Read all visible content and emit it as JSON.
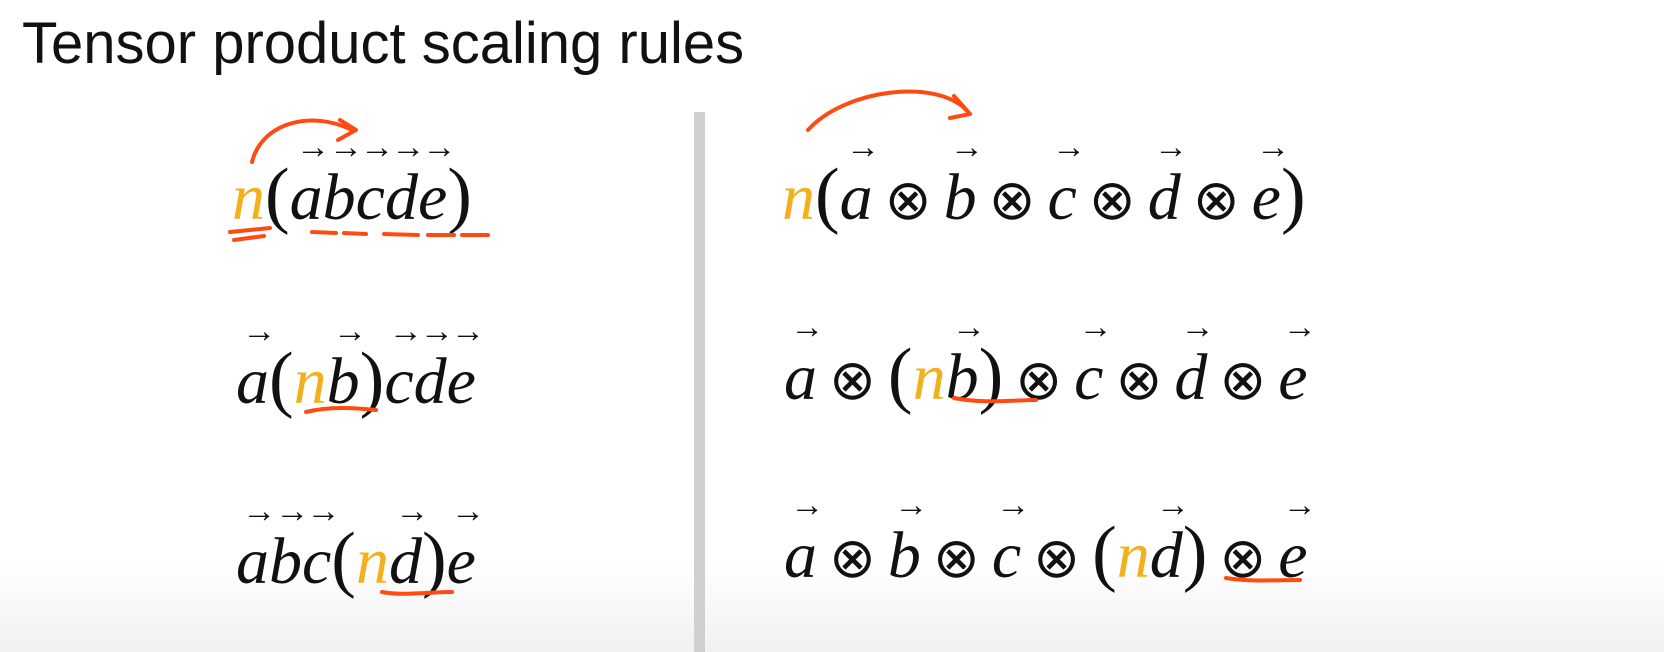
{
  "title": "Tensor product scaling rules",
  "icons": [
    "arrow-annotation",
    "underline-annotation"
  ],
  "colors": {
    "scalar": "#f2b01e",
    "annotation": "#ff4b12",
    "text": "#111111",
    "divider": "#d0d0d0"
  },
  "left": {
    "row1": {
      "n": "n",
      "lp": "(",
      "a": "a",
      "b": "b",
      "c": "c",
      "d": "d",
      "e": "e",
      "rp": ")"
    },
    "row2": {
      "a": "a",
      "lp": "(",
      "n": "n",
      "b": "b",
      "rp": ")",
      "c": "c",
      "d": "d",
      "e": "e"
    },
    "row3": {
      "a": "a",
      "b": "b",
      "c": "c",
      "lp": "(",
      "n": "n",
      "d": "d",
      "rp": ")",
      "e": "e"
    }
  },
  "right": {
    "otimes": "⊗",
    "row1": {
      "n": "n",
      "lp": "(",
      "a": "a",
      "b": "b",
      "c": "c",
      "d": "d",
      "e": "e",
      "rp": ")"
    },
    "row2": {
      "a": "a",
      "lp": "(",
      "n": "n",
      "b": "b",
      "rp": ")",
      "c": "c",
      "d": "d",
      "e": "e"
    },
    "row3": {
      "a": "a",
      "b": "b",
      "c": "c",
      "lp": "(",
      "n": "n",
      "d": "d",
      "rp": ")",
      "e": "e"
    }
  }
}
